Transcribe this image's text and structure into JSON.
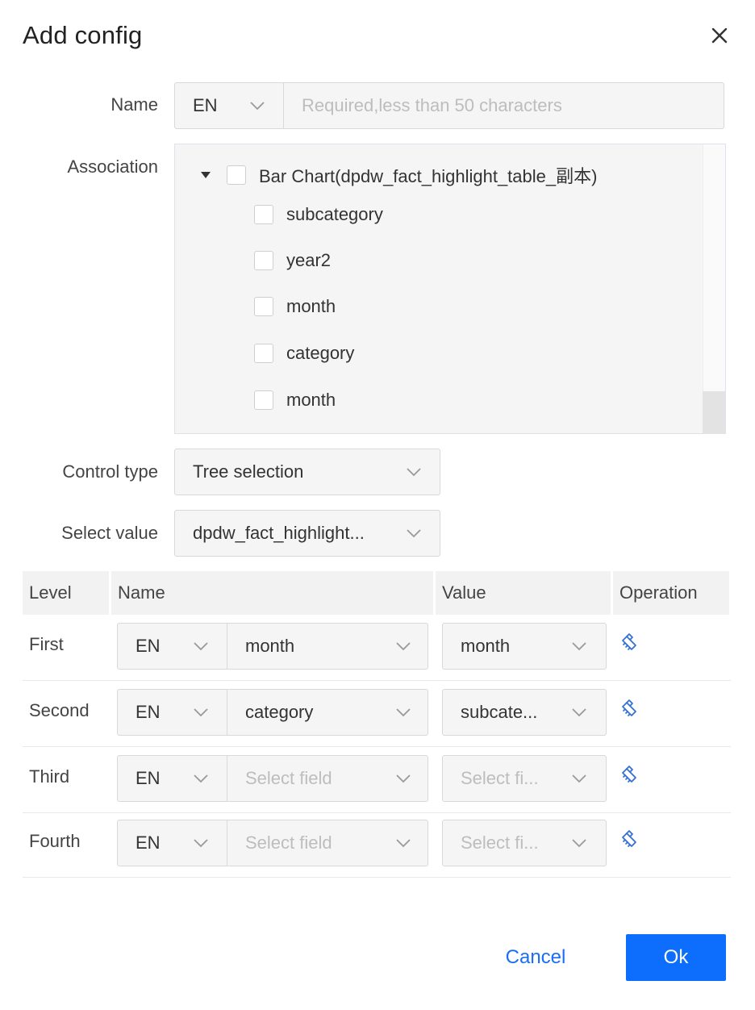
{
  "dialog": {
    "title": "Add config",
    "close_icon": "close-icon"
  },
  "form": {
    "name_label": "Name",
    "name_lang": "EN",
    "name_placeholder": "Required,less than 50 characters",
    "association_label": "Association",
    "control_type_label": "Control type",
    "control_type_value": "Tree selection",
    "select_value_label": "Select value",
    "select_value_value": "dpdw_fact_highlight..."
  },
  "tree": {
    "root_label": "Bar Chart(dpdw_fact_highlight_table_副本)",
    "children": [
      {
        "label": "subcategory"
      },
      {
        "label": "year2"
      },
      {
        "label": "month"
      },
      {
        "label": "category"
      },
      {
        "label": "month"
      }
    ]
  },
  "table": {
    "headers": [
      "Level",
      "Name",
      "Value",
      "Operation"
    ],
    "rows": [
      {
        "level": "First",
        "lang": "EN",
        "name": "month",
        "name_placeholder": false,
        "value": "month",
        "value_placeholder": false,
        "op_icon": "clear-icon"
      },
      {
        "level": "Second",
        "lang": "EN",
        "name": "category",
        "name_placeholder": false,
        "value": "subcate...",
        "value_placeholder": false,
        "op_icon": "clear-icon"
      },
      {
        "level": "Third",
        "lang": "EN",
        "name": "Select field",
        "name_placeholder": true,
        "value": "Select fi...",
        "value_placeholder": true,
        "op_icon": "clear-icon"
      },
      {
        "level": "Fourth",
        "lang": "EN",
        "name": "Select field",
        "name_placeholder": true,
        "value": "Select fi...",
        "value_placeholder": true,
        "op_icon": "clear-icon"
      }
    ]
  },
  "footer": {
    "cancel_label": "Cancel",
    "ok_label": "Ok"
  },
  "colors": {
    "accent": "#0d6efd",
    "link": "#1a6ef5",
    "icon_blue": "#2f6fd6"
  }
}
